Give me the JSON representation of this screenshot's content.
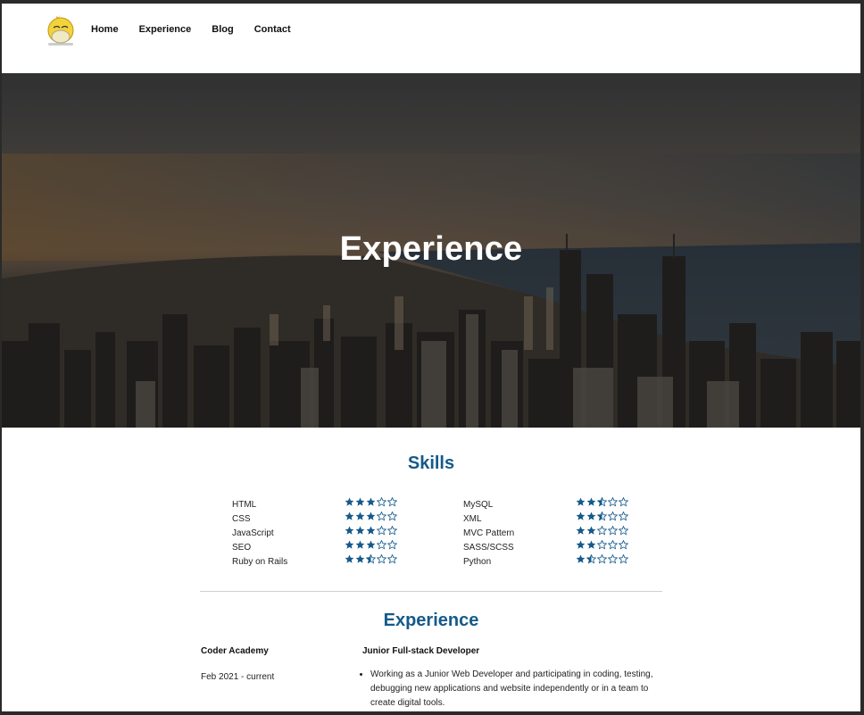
{
  "colors": {
    "accent": "#155a8a",
    "star": "#155a8a",
    "logo_body": "#f4d23a",
    "logo_beak": "#efe9c4"
  },
  "nav": {
    "logo_icon": "duck-logo-icon",
    "items": [
      "Home",
      "Experience",
      "Blog",
      "Contact"
    ]
  },
  "hero": {
    "title": "Experience",
    "background": "city-skyline-photo"
  },
  "skills": {
    "title": "Skills",
    "left": [
      {
        "name": "HTML",
        "rating": 3
      },
      {
        "name": "CSS",
        "rating": 3
      },
      {
        "name": "JavaScript",
        "rating": 3
      },
      {
        "name": "SEO",
        "rating": 3
      },
      {
        "name": "Ruby on Rails",
        "rating": 2.5
      }
    ],
    "right": [
      {
        "name": "MySQL",
        "rating": 2.5
      },
      {
        "name": "XML",
        "rating": 2.5
      },
      {
        "name": "MVC Pattern",
        "rating": 2
      },
      {
        "name": "SASS/SCSS",
        "rating": 2
      },
      {
        "name": "Python",
        "rating": 1.5
      }
    ],
    "max_rating": 5
  },
  "experience": {
    "title": "Experience",
    "company": "Coder Academy",
    "date": "Feb 2021 - current",
    "role": "Junior Full-stack Developer",
    "bullets": [
      "Working as a Junior Web Developer and participating in coding, testing, debugging new applications and website independently or in a team to create digital tools."
    ]
  }
}
